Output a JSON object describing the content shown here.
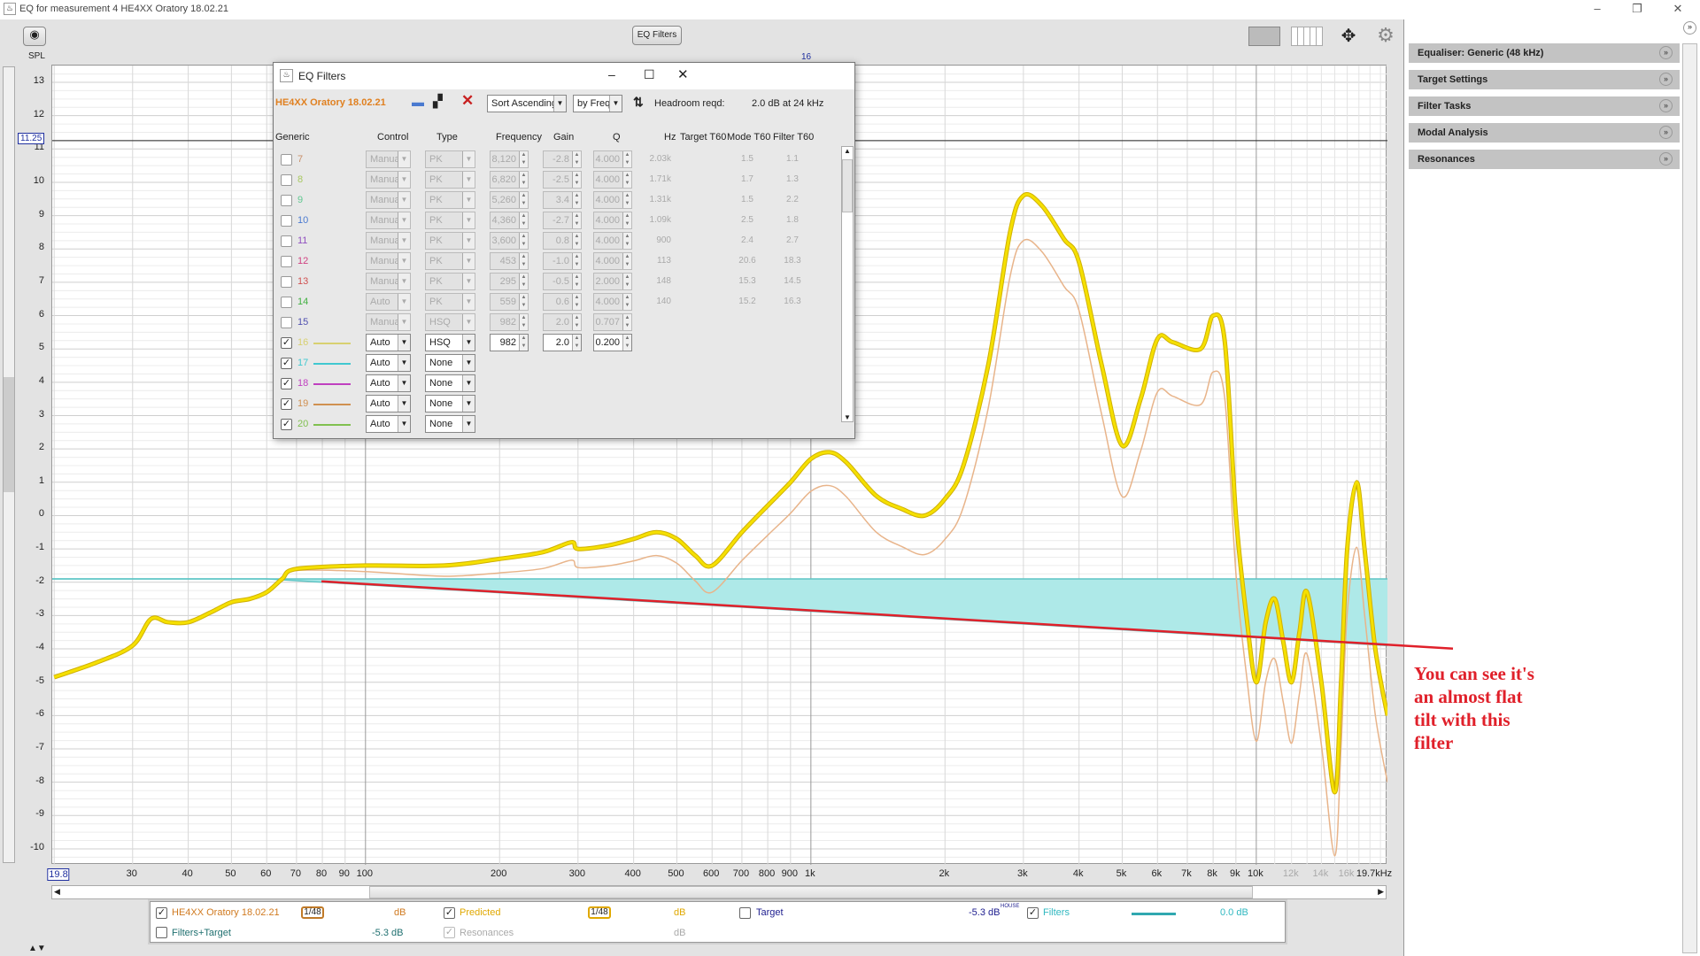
{
  "window": {
    "title": "EQ for measurement 4 HE4XX Oratory 18.02.21",
    "minimize": "–",
    "restore": "❐",
    "close": "✕"
  },
  "toolbar": {
    "eq_filters_label": "EQ Filters",
    "spl_label": "SPL",
    "filter_marker": "16",
    "y_cursor_value": "11.25",
    "icons": [
      "camera-icon",
      "layout-icon",
      "columns-icon",
      "move-arrows-icon",
      "gear-icon"
    ]
  },
  "right_panel": {
    "items": [
      {
        "label": "Equaliser: Generic (48 kHz)"
      },
      {
        "label": "Target Settings"
      },
      {
        "label": "Filter Tasks"
      },
      {
        "label": "Modal Analysis"
      },
      {
        "label": "Resonances"
      }
    ]
  },
  "dialog": {
    "title": "EQ Filters",
    "measurement": "HE4XX Oratory 18.02.21",
    "sort_order": "Sort Ascending",
    "sort_by": "by Freq",
    "headroom_label": "Headroom reqd:",
    "headroom_value": "2.0 dB at 24 kHz",
    "columns": {
      "generic": "Generic",
      "control": "Control",
      "type": "Type",
      "frequency": "Frequency",
      "gain": "Gain",
      "q": "Q",
      "hz": "Hz",
      "target_t60": "Target T60",
      "mode_t60": "Mode T60",
      "filter_t60": "Filter T60"
    },
    "rows": [
      {
        "num": "7",
        "color": "#c8906a",
        "checked": false,
        "enabled": false,
        "control": "Manual",
        "type": "PK",
        "freq": "8,120",
        "gain": "-2.8",
        "q": "4.000",
        "hz": "2.03k",
        "mode_t60": "1.5",
        "filter_t60": "1.1"
      },
      {
        "num": "8",
        "color": "#a8c860",
        "checked": false,
        "enabled": false,
        "control": "Manual",
        "type": "PK",
        "freq": "6,820",
        "gain": "-2.5",
        "q": "4.000",
        "hz": "1.71k",
        "mode_t60": "1.7",
        "filter_t60": "1.3"
      },
      {
        "num": "9",
        "color": "#60c890",
        "checked": false,
        "enabled": false,
        "control": "Manual",
        "type": "PK",
        "freq": "5,260",
        "gain": "3.4",
        "q": "4.000",
        "hz": "1.31k",
        "mode_t60": "1.5",
        "filter_t60": "2.2"
      },
      {
        "num": "10",
        "color": "#4a7ad0",
        "checked": false,
        "enabled": false,
        "control": "Manual",
        "type": "PK",
        "freq": "4,360",
        "gain": "-2.7",
        "q": "4.000",
        "hz": "1.09k",
        "mode_t60": "2.5",
        "filter_t60": "1.8"
      },
      {
        "num": "11",
        "color": "#9050c0",
        "checked": false,
        "enabled": false,
        "control": "Manual",
        "type": "PK",
        "freq": "3,600",
        "gain": "0.8",
        "q": "4.000",
        "hz": "900",
        "mode_t60": "2.4",
        "filter_t60": "2.7"
      },
      {
        "num": "12",
        "color": "#d04080",
        "checked": false,
        "enabled": false,
        "control": "Manual",
        "type": "PK",
        "freq": "453",
        "gain": "-1.0",
        "q": "4.000",
        "hz": "113",
        "mode_t60": "20.6",
        "filter_t60": "18.3"
      },
      {
        "num": "13",
        "color": "#d05050",
        "checked": false,
        "enabled": false,
        "control": "Manual",
        "type": "PK",
        "freq": "295",
        "gain": "-0.5",
        "q": "2.000",
        "hz": "148",
        "mode_t60": "15.3",
        "filter_t60": "14.5"
      },
      {
        "num": "14",
        "color": "#40b040",
        "checked": false,
        "enabled": false,
        "control": "Auto",
        "type": "PK",
        "freq": "559",
        "gain": "0.6",
        "q": "4.000",
        "hz": "140",
        "mode_t60": "15.2",
        "filter_t60": "16.3"
      },
      {
        "num": "15",
        "color": "#5050b0",
        "checked": false,
        "enabled": false,
        "control": "Manual",
        "type": "HSQ",
        "freq": "982",
        "gain": "2.0",
        "q": "0.707",
        "hz": "",
        "mode_t60": "",
        "filter_t60": ""
      },
      {
        "num": "16",
        "color": "#d8d070",
        "checked": true,
        "enabled": true,
        "control": "Auto",
        "type": "HSQ",
        "freq": "982",
        "gain": "2.0",
        "q": "0.200",
        "hz": "",
        "mode_t60": "",
        "filter_t60": ""
      },
      {
        "num": "17",
        "color": "#40c8d0",
        "checked": true,
        "enabled": true,
        "control": "Auto",
        "type": "None"
      },
      {
        "num": "18",
        "color": "#c040c0",
        "checked": true,
        "enabled": true,
        "control": "Auto",
        "type": "None"
      },
      {
        "num": "19",
        "color": "#d09050",
        "checked": true,
        "enabled": true,
        "control": "Auto",
        "type": "None"
      },
      {
        "num": "20",
        "color": "#80c050",
        "checked": true,
        "enabled": true,
        "control": "Auto",
        "type": "None"
      }
    ]
  },
  "legend": {
    "measurement": {
      "label": "HE4XX Oratory 18.02.21",
      "smoothing": "1/48",
      "unit": "dB",
      "checked": true,
      "color": "#d07a20"
    },
    "predicted": {
      "label": "Predicted",
      "smoothing": "1/48",
      "unit": "dB",
      "checked": true,
      "color": "#e0a800"
    },
    "target": {
      "label": "Target",
      "value": "-5.3 dB",
      "superscript": "HOUSE",
      "checked": false,
      "color": "#202090"
    },
    "filters": {
      "label": "Filters",
      "value": "0.0 dB",
      "checked": true,
      "color": "#30b8c0"
    },
    "filters_target": {
      "label": "Filters+Target",
      "value": "-5.3 dB",
      "checked": false,
      "color": "#207070"
    },
    "resonances": {
      "label": "Resonances",
      "unit": "dB",
      "checked": true,
      "disabled": true
    }
  },
  "annotation": {
    "text": "You can see it's an almost flat tilt with this filter",
    "lines": [
      "You can see it's",
      "an almost flat",
      "tilt with this",
      "filter"
    ],
    "color": "#e0202a"
  },
  "chart_data": {
    "type": "line",
    "xscale": "log",
    "xlim": [
      19.8,
      19700
    ],
    "ylim": [
      -10.5,
      13.5
    ],
    "ylabel": "SPL",
    "grid": true,
    "x_tick_labels": [
      "19.8",
      "30",
      "40",
      "50",
      "60",
      "70",
      "80",
      "90",
      "100",
      "200",
      "300",
      "400",
      "500",
      "600",
      "700",
      "800",
      "900",
      "1k",
      "2k",
      "3k",
      "4k",
      "5k",
      "6k",
      "7k",
      "8k",
      "9k",
      "10k",
      "12k",
      "14k",
      "16k",
      "19.7kHz"
    ],
    "x_tick_values": [
      19.8,
      30,
      40,
      50,
      60,
      70,
      80,
      90,
      100,
      200,
      300,
      400,
      500,
      600,
      700,
      800,
      900,
      1000,
      2000,
      3000,
      4000,
      5000,
      6000,
      7000,
      8000,
      9000,
      10000,
      12000,
      14000,
      16000,
      19700
    ],
    "y_ticks": [
      13,
      12,
      11,
      10,
      9,
      8,
      7,
      6,
      5,
      4,
      3,
      2,
      1,
      0,
      -1,
      -2,
      -3,
      -4,
      -5,
      -6,
      -7,
      -8,
      -9,
      -10
    ],
    "freq": [
      20,
      25,
      30,
      33,
      36,
      40,
      45,
      50,
      55,
      60,
      65,
      70,
      100,
      150,
      200,
      250,
      290,
      300,
      350,
      400,
      450,
      500,
      550,
      600,
      700,
      800,
      900,
      1000,
      1100,
      1200,
      1400,
      1600,
      1800,
      2000,
      2200,
      2500,
      2800,
      3000,
      3300,
      3700,
      4000,
      4500,
      5000,
      5500,
      6000,
      6500,
      7500,
      8000,
      8500,
      9000,
      9500,
      10000,
      10500,
      11000,
      11500,
      12000,
      12500,
      13000,
      14000,
      15000,
      15500,
      16000,
      16800,
      17500,
      18500,
      19700
    ],
    "series": [
      {
        "name": "Predicted",
        "color": "#f5e000",
        "values": [
          -4.85,
          -4.4,
          -3.9,
          -3.1,
          -3.2,
          -3.2,
          -2.9,
          -2.6,
          -2.5,
          -2.3,
          -1.9,
          -1.6,
          -1.5,
          -1.5,
          -1.3,
          -1.1,
          -0.8,
          -1.0,
          -0.9,
          -0.7,
          -0.5,
          -0.7,
          -1.2,
          -1.5,
          -0.5,
          0.3,
          1.0,
          1.7,
          1.9,
          1.6,
          0.6,
          0.2,
          0.0,
          0.5,
          1.5,
          4.5,
          8.5,
          9.6,
          9.3,
          8.3,
          7.6,
          4.5,
          2.1,
          3.5,
          5.3,
          5.2,
          5.0,
          6.0,
          5.2,
          0,
          -3,
          -5.0,
          -3.2,
          -2.5,
          -3.8,
          -5.0,
          -3.5,
          -2.3,
          -5,
          -8.3,
          -5,
          -1,
          1.0,
          -1,
          -4,
          -6
        ]
      },
      {
        "name": "HE4XX Oratory 18.02.21",
        "color": "#e8b48a",
        "values": [
          -4.85,
          -4.4,
          -3.9,
          -3.1,
          -3.2,
          -3.2,
          -2.9,
          -2.6,
          -2.5,
          -2.3,
          -1.93,
          -1.65,
          -1.68,
          -1.82,
          -1.72,
          -1.59,
          -1.34,
          -1.56,
          -1.51,
          -1.36,
          -1.2,
          -1.43,
          -1.96,
          -2.3,
          -1.35,
          -0.59,
          0.07,
          0.73,
          0.9,
          0.57,
          -0.49,
          -0.93,
          -1.17,
          -0.71,
          0.26,
          3.21,
          7.17,
          8.25,
          7.92,
          6.88,
          6.15,
          3.01,
          0.57,
          1.94,
          3.71,
          3.58,
          3.33,
          4.31,
          3.49,
          -1.73,
          -4.75,
          -6.77,
          -4.98,
          -4.3,
          -5.61,
          -6.83,
          -5.34,
          -4.16,
          -6.88,
          -10.21,
          -6.92,
          -2.93,
          -0.95,
          -2.96,
          -5.98,
          -8.0
        ]
      },
      {
        "name": "Filters",
        "color": "#5fc6c6",
        "fill": "#aee9e8",
        "freq": [
          19.8,
          60,
          19700
        ],
        "values": [
          -1.9,
          -1.9,
          -3.9
        ],
        "baseline": -1.9
      }
    ],
    "annotation_line": {
      "color": "#e0202a",
      "from": [
        80,
        -2.0
      ],
      "to": [
        19700,
        -3.9
      ]
    }
  }
}
